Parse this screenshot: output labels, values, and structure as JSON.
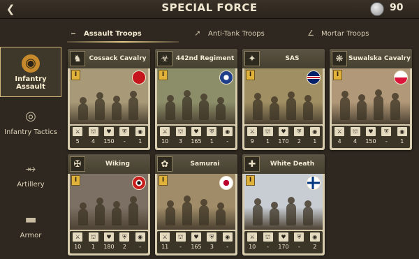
{
  "header": {
    "title": "SPECIAL FORCE",
    "medal_count": "90"
  },
  "tabs": [
    {
      "label": "Assault Troops",
      "active": true
    },
    {
      "label": "Anti-Tank Troops",
      "active": false
    },
    {
      "label": "Mortar Troops",
      "active": false
    }
  ],
  "sidebar": [
    {
      "label": "Infantry Assault",
      "icon": "helmet-icon",
      "active": true
    },
    {
      "label": "Infantry Tactics",
      "icon": "gas-mask-icon",
      "active": false
    },
    {
      "label": "Artillery",
      "icon": "cannon-icon",
      "active": false
    },
    {
      "label": "Armor",
      "icon": "tank-icon",
      "active": false
    }
  ],
  "units": [
    {
      "name": "Cossack Cavalry",
      "tier": "I",
      "flag": "soviet-flag-icon",
      "unit_icon": "horse-head-icon",
      "art_color": "#a89a78",
      "stats": [
        "5",
        "4",
        "150",
        "-",
        "1"
      ]
    },
    {
      "name": "442nd Regiment",
      "tier": "I",
      "flag": "usa-flag-icon",
      "unit_icon": "torch-icon",
      "art_color": "#8c8e6a",
      "stats": [
        "10",
        "3",
        "165",
        "1",
        "-"
      ]
    },
    {
      "name": "SAS",
      "tier": "I",
      "flag": "uk-flag-icon",
      "unit_icon": "winged-dagger-icon",
      "art_color": "#a08f62",
      "stats": [
        "9",
        "1",
        "170",
        "2",
        "1"
      ]
    },
    {
      "name": "Suwalska Cavalry",
      "tier": "I",
      "flag": "poland-flag-icon",
      "unit_icon": "eagle-icon",
      "art_color": "#b19878",
      "stats": [
        "4",
        "4",
        "150",
        "-",
        "1"
      ]
    },
    {
      "name": "Wiking",
      "tier": "I",
      "flag": "germany-flag-icon",
      "unit_icon": "wolfsangel-icon",
      "art_color": "#7c7064",
      "stats": [
        "10",
        "1",
        "180",
        "2",
        "-"
      ]
    },
    {
      "name": "Samurai",
      "tier": "I",
      "flag": "japan-flag-icon",
      "unit_icon": "flower-crest-icon",
      "art_color": "#a08c68",
      "stats": [
        "11",
        "-",
        "165",
        "3",
        "-"
      ]
    },
    {
      "name": "White Death",
      "tier": "I",
      "flag": "finland-flag-icon",
      "unit_icon": "cross-emblem-icon",
      "art_color": "#c8cdd4",
      "stats": [
        "10",
        "-",
        "170",
        "-",
        "2"
      ]
    }
  ],
  "stat_icons": [
    "swords-icon",
    "boot-icon",
    "heart-icon",
    "shield-icon",
    "eye-icon"
  ]
}
